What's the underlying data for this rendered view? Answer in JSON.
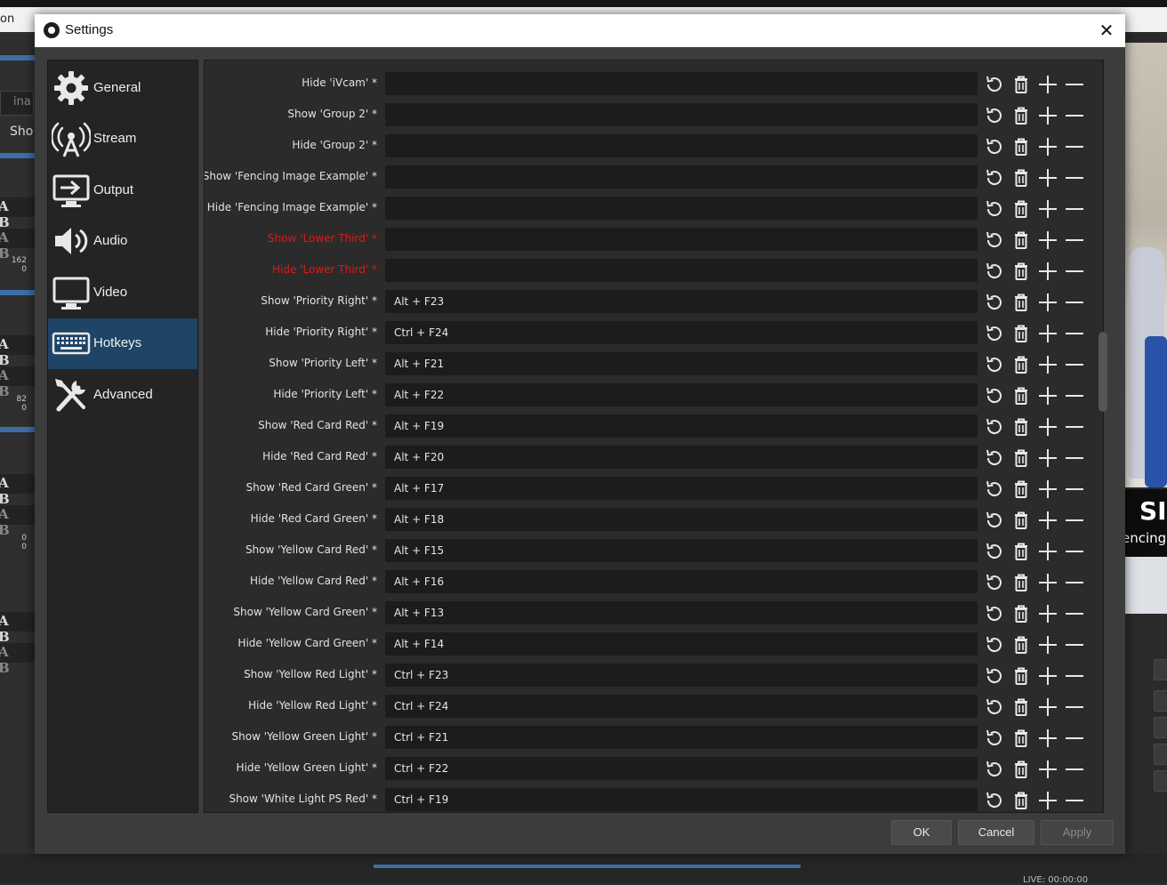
{
  "background": {
    "menu_fragment": "on",
    "left_fragments": {
      "input_hint": "ina",
      "show_hint": "Sho",
      "ab": "A B",
      "vol1": "162",
      "vol1b": "0",
      "vol2": "82",
      "vol2b": "0",
      "vol3": "0",
      "vol3b": "0"
    },
    "right_banner": {
      "big": "SIA",
      "small": "encing"
    },
    "status": "LIVE: 00:00:00"
  },
  "dialog": {
    "title": "Settings",
    "close_glyph": "✕"
  },
  "sidebar": {
    "items": [
      {
        "label": "General",
        "icon": "gear-icon"
      },
      {
        "label": "Stream",
        "icon": "antenna-icon"
      },
      {
        "label": "Output",
        "icon": "monitor-output-icon"
      },
      {
        "label": "Audio",
        "icon": "speaker-icon"
      },
      {
        "label": "Video",
        "icon": "monitor-icon"
      },
      {
        "label": "Hotkeys",
        "icon": "keyboard-icon",
        "active": true
      },
      {
        "label": "Advanced",
        "icon": "tools-icon"
      }
    ]
  },
  "hotkeys": [
    {
      "label": "Hide 'iVcam' *",
      "key": "",
      "red": false
    },
    {
      "label": "Show 'Group 2' *",
      "key": "",
      "red": false
    },
    {
      "label": "Hide 'Group 2' *",
      "key": "",
      "red": false
    },
    {
      "label": "Show 'Fencing Image Example' *",
      "key": "",
      "red": false
    },
    {
      "label": "Hide 'Fencing Image Example' *",
      "key": "",
      "red": false
    },
    {
      "label": "Show 'Lower Third' *",
      "key": "",
      "red": true
    },
    {
      "label": "Hide 'Lower Third' *",
      "key": "",
      "red": true
    },
    {
      "label": "Show 'Priority Right' *",
      "key": "Alt + F23",
      "red": false
    },
    {
      "label": "Hide 'Priority Right' *",
      "key": "Ctrl + F24",
      "red": false
    },
    {
      "label": "Show 'Priority Left' *",
      "key": "Alt + F21",
      "red": false
    },
    {
      "label": "Hide 'Priority Left' *",
      "key": "Alt + F22",
      "red": false
    },
    {
      "label": "Show 'Red Card Red' *",
      "key": "Alt + F19",
      "red": false
    },
    {
      "label": "Hide 'Red Card Red' *",
      "key": "Alt + F20",
      "red": false
    },
    {
      "label": "Show 'Red Card Green' *",
      "key": "Alt + F17",
      "red": false
    },
    {
      "label": "Hide 'Red Card Green' *",
      "key": "Alt + F18",
      "red": false
    },
    {
      "label": "Show 'Yellow Card Red' *",
      "key": "Alt + F15",
      "red": false
    },
    {
      "label": "Hide 'Yellow Card Red' *",
      "key": "Alt + F16",
      "red": false
    },
    {
      "label": "Show 'Yellow Card Green' *",
      "key": "Alt + F13",
      "red": false
    },
    {
      "label": "Hide 'Yellow Card Green' *",
      "key": "Alt + F14",
      "red": false
    },
    {
      "label": "Show 'Yellow Red Light' *",
      "key": "Ctrl + F23",
      "red": false
    },
    {
      "label": "Hide 'Yellow Red Light' *",
      "key": "Ctrl + F24",
      "red": false
    },
    {
      "label": "Show 'Yellow Green Light' *",
      "key": "Ctrl + F21",
      "red": false
    },
    {
      "label": "Hide 'Yellow Green Light' *",
      "key": "Ctrl + F22",
      "red": false
    },
    {
      "label": "Show 'White Light PS Red' *",
      "key": "Ctrl + F19",
      "red": false
    }
  ],
  "row_buttons": [
    "revert-icon",
    "trash-icon",
    "plus-icon",
    "minus-icon"
  ],
  "footer": {
    "ok": "OK",
    "cancel": "Cancel",
    "apply": "Apply"
  },
  "colors": {
    "accent": "#1e4466",
    "error_label": "#e01818",
    "field_bg": "#1c1c1c"
  }
}
